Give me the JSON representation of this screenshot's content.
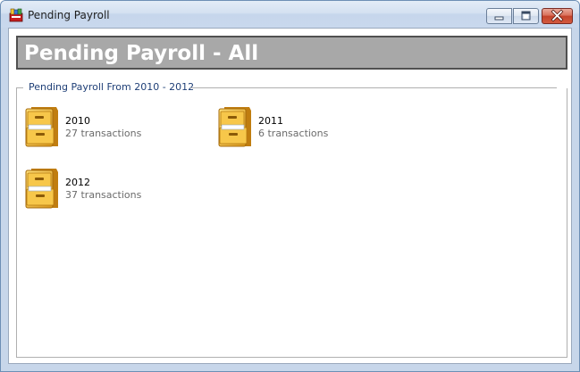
{
  "window": {
    "title": "Pending Payroll",
    "app_icon": "payroll-app-icon",
    "controls": [
      "minimize-icon",
      "maximize-icon",
      "close-icon"
    ]
  },
  "header": {
    "title": "Pending Payroll - All",
    "background": "#a8a8a8",
    "text_color": "#ffffff"
  },
  "group": {
    "title": "Pending Payroll From 2010 - 2012",
    "title_color": "#1f3f77"
  },
  "folders": [
    {
      "year": "2010",
      "count": "27 transactions",
      "icon": "file-cabinet-icon"
    },
    {
      "year": "2011",
      "count": "6 transactions",
      "icon": "file-cabinet-icon"
    },
    {
      "year": "2012",
      "count": "37 transactions",
      "icon": "file-cabinet-icon"
    }
  ]
}
